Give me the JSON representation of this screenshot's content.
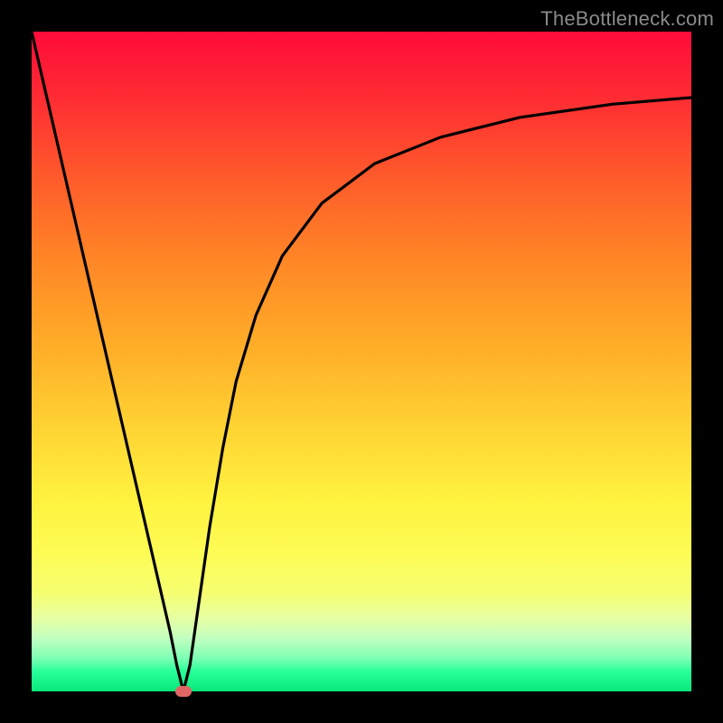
{
  "watermark": "TheBottleneck.com",
  "chart_data": {
    "type": "line",
    "title": "",
    "xlabel": "",
    "ylabel": "",
    "xlim": [
      0,
      100
    ],
    "ylim": [
      0,
      100
    ],
    "grid": false,
    "legend": false,
    "background": "rainbow-gradient",
    "series": [
      {
        "name": "bottleneck-curve",
        "x": [
          0,
          3,
          6,
          9,
          12,
          15,
          18,
          21,
          22,
          23,
          24,
          25,
          27,
          29,
          31,
          34,
          38,
          44,
          52,
          62,
          74,
          88,
          100
        ],
        "y": [
          100,
          87,
          74,
          61,
          48,
          35,
          22,
          9,
          4,
          0,
          4,
          11,
          25,
          37,
          47,
          57,
          66,
          74,
          80,
          84,
          87,
          89,
          90
        ]
      }
    ],
    "marker": {
      "x": 23,
      "y": 0,
      "color": "#e06666"
    }
  },
  "colors": {
    "frame": "#000000",
    "curve": "#000000",
    "marker": "#e06666",
    "watermark": "#8a8a8a"
  }
}
